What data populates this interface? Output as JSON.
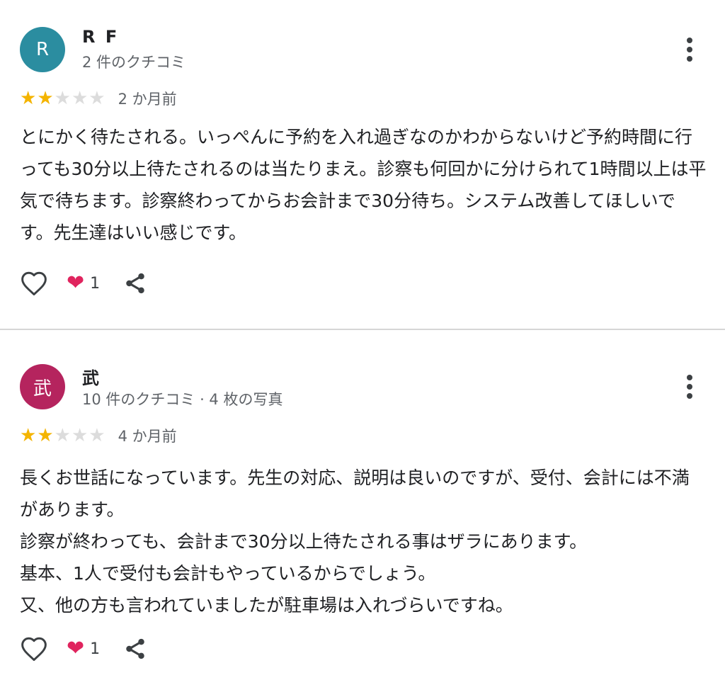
{
  "colors": {
    "star_filled": "#f4b400",
    "star_empty": "#dcdcdc",
    "heart": "#e0245e",
    "icon": "#3c4043"
  },
  "icons": {
    "like": "heart-outline-icon",
    "reaction": "heart-emoji-icon",
    "share": "share-icon",
    "more": "more-vert-icon"
  },
  "reviews": [
    {
      "avatar_letter": "R",
      "avatar_color": "#2b8da0",
      "author": "R F",
      "meta": "2 件のクチコミ",
      "rating": 2,
      "max_rating": 5,
      "date": "2 か月前",
      "text": "とにかく待たされる。いっぺんに予約を入れ過ぎなのかわからないけど予約時間に行っても30分以上待たされるのは当たりまえ。診察も何回かに分けられて1時間以上は平気で待ちます。診察終わってからお会計まで30分待ち。システム改善してほしいです。先生達はいい感じです。",
      "reaction_count": "1"
    },
    {
      "avatar_letter": "武",
      "avatar_color": "#b5245e",
      "author": "武",
      "meta": "10 件のクチコミ · 4 枚の写真",
      "rating": 2,
      "max_rating": 5,
      "date": "4 か月前",
      "text": "長くお世話になっています。先生の対応、説明は良いのですが、受付、会計には不満があります。\n診察が終わっても、会計まで30分以上待たされる事はザラにあります。\n基本、1人で受付も会計もやっているからでしょう。\n又、他の方も言われていましたが駐車場は入れづらいですね。",
      "reaction_count": "1"
    }
  ]
}
